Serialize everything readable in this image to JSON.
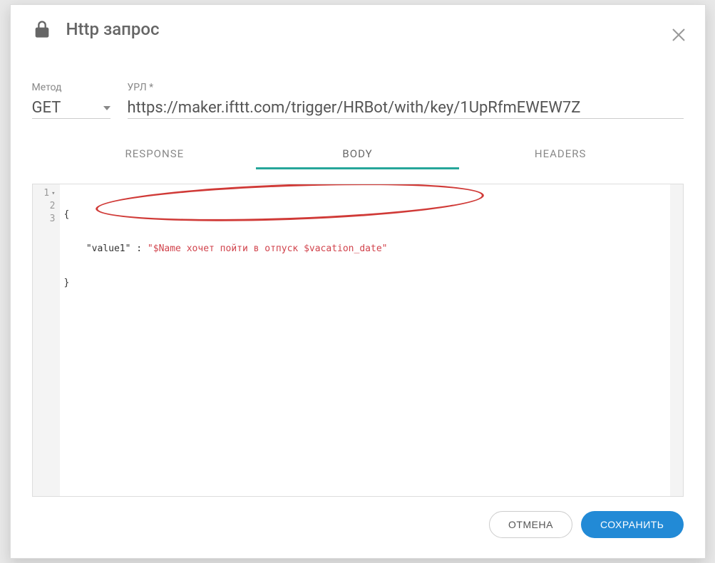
{
  "modal": {
    "title": "Http запрос"
  },
  "fields": {
    "method_label": "Метод",
    "method_value": "GET",
    "url_label": "УРЛ *",
    "url_value": "https://maker.ifttt.com/trigger/HRBot/with/key/1UpRfmEWEW7Z"
  },
  "tabs": {
    "response": "RESPONSE",
    "body": "BODY",
    "headers": "HEADERS",
    "active": "body"
  },
  "editor": {
    "lines": [
      {
        "no": "1",
        "text_plain": "{"
      },
      {
        "no": "2",
        "indent": "    ",
        "key": "\"value1\"",
        "sep": " : ",
        "val": "\"$Name хочет пойти в отпуск $vacation_date\""
      },
      {
        "no": "3",
        "text_plain": "}"
      }
    ]
  },
  "footer": {
    "cancel": "ОТМЕНА",
    "save": "СОХРАНИТЬ"
  }
}
